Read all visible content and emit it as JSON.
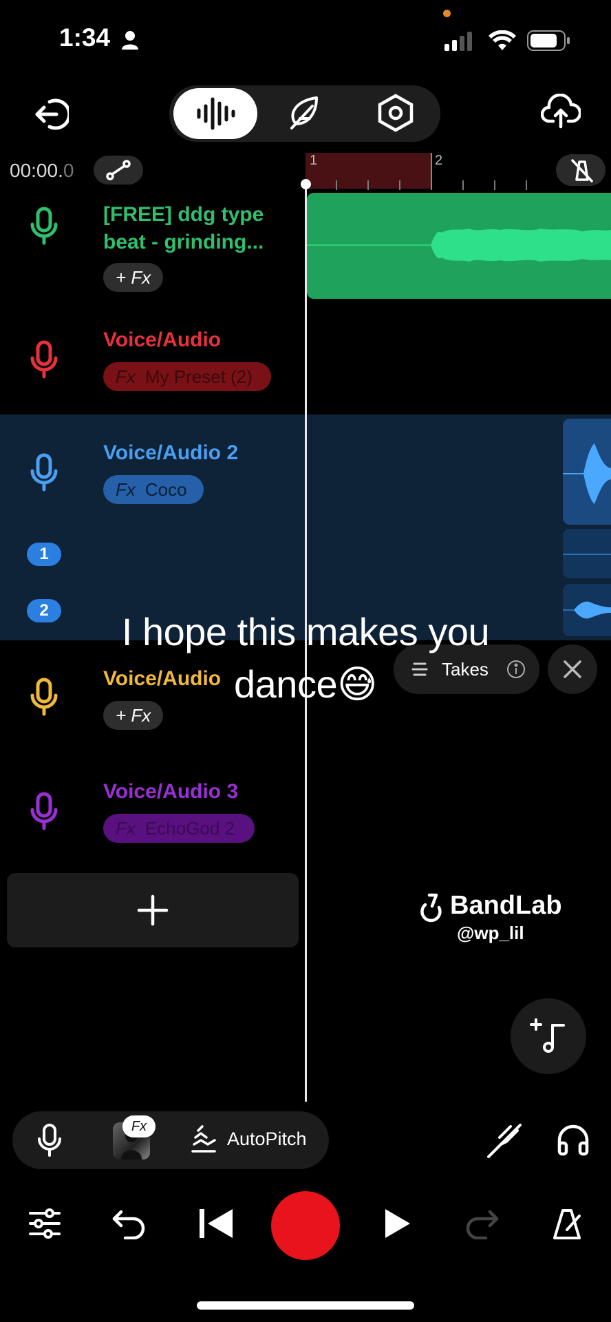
{
  "status_bar": {
    "time": "1:34"
  },
  "toolbar": {
    "time_display": "00:00.",
    "time_display_dim": "0",
    "ruler_markers": [
      "1",
      "2"
    ]
  },
  "tracks": [
    {
      "name": "[FREE] ddg type beat - grinding...",
      "fx": "+ Fx",
      "color": "#2fbf6d"
    },
    {
      "name": "Voice/Audio",
      "fx_label": "Fx",
      "fx_preset": "My Preset (2)",
      "color": "#e8313b"
    },
    {
      "name": "Voice/Audio 2",
      "fx_label": "Fx",
      "fx_preset": "Coco",
      "color": "#4a9ff0",
      "takes": [
        "1",
        "2"
      ]
    },
    {
      "name": "Voice/Audio",
      "fx": "+ Fx",
      "color": "#f0b93a"
    },
    {
      "name": "Voice/Audio 3",
      "fx_label": "Fx",
      "fx_preset": "EchoGod 2",
      "color": "#9b2fd6"
    }
  ],
  "takes_popup": {
    "label": "Takes"
  },
  "caption": {
    "line1": "I hope this makes you",
    "line2": "dance😅"
  },
  "watermark": {
    "brand": "BandLab",
    "handle": "@wp_lil"
  },
  "bottom_bar": {
    "fx_badge": "Fx",
    "autopitch_label": "AutoPitch"
  }
}
